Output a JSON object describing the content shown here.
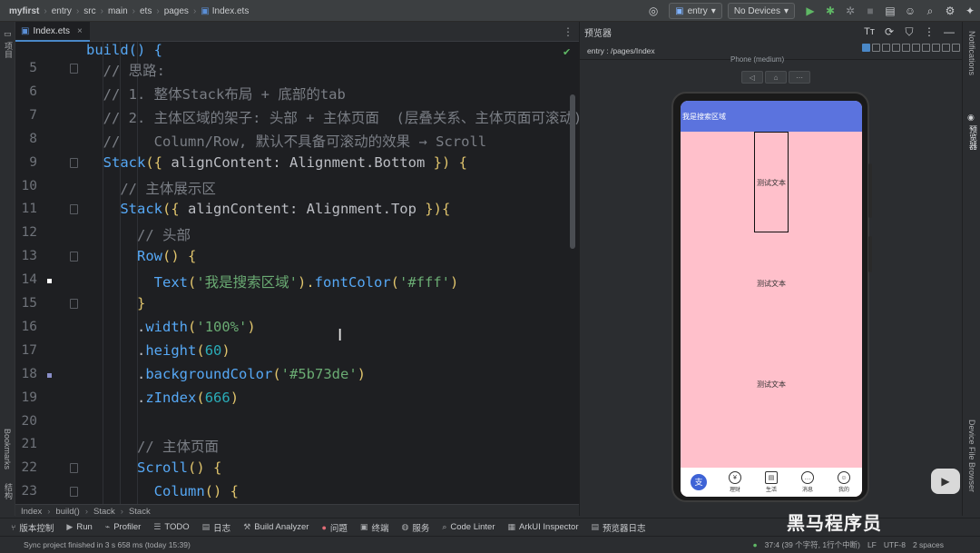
{
  "titlebar": {
    "crumbs": [
      "myfirst",
      "entry",
      "src",
      "main",
      "ets",
      "pages",
      "Index.ets"
    ],
    "entry_dropdown": "entry",
    "devices_dropdown": "No Devices"
  },
  "leftstrip": {
    "project": "项目",
    "bookmarks": "Bookmarks",
    "structure": "结构"
  },
  "editor": {
    "tab": "Index.ets",
    "line_numbers": [
      "5",
      "6",
      "7",
      "8",
      "9",
      "10",
      "11",
      "12",
      "13",
      "14",
      "15",
      "16",
      "17",
      "18",
      "19",
      "20",
      "21",
      "22",
      "23"
    ],
    "partial_first_line": "build() {",
    "lines": [
      {
        "indent": "  ",
        "tokens": [
          {
            "t": "// 思路:",
            "c": "cm"
          }
        ]
      },
      {
        "indent": "  ",
        "tokens": [
          {
            "t": "// 1. 整体Stack布局 + 底部的tab",
            "c": "cm"
          }
        ]
      },
      {
        "indent": "  ",
        "tokens": [
          {
            "t": "// 2. 主体区域的架子: 头部 + 主体页面  (层叠关系、主体页面可滚动)",
            "c": "cm"
          }
        ]
      },
      {
        "indent": "  ",
        "tokens": [
          {
            "t": "//    Column/Row, 默认不具备可滚动的效果 → Scroll",
            "c": "cm"
          }
        ]
      },
      {
        "indent": "  ",
        "tokens": [
          {
            "t": "Stack",
            "c": "fn"
          },
          {
            "t": "({ ",
            "c": "br"
          },
          {
            "t": "alignContent",
            "c": ""
          },
          {
            "t": ": Alignment.",
            "c": ""
          },
          {
            "t": "Bottom",
            "c": ""
          },
          {
            "t": " }) {",
            "c": "br"
          }
        ]
      },
      {
        "indent": "    ",
        "tokens": [
          {
            "t": "// 主体展示区",
            "c": "cm"
          }
        ]
      },
      {
        "indent": "    ",
        "tokens": [
          {
            "t": "Stack",
            "c": "fn"
          },
          {
            "t": "({ ",
            "c": "br"
          },
          {
            "t": "alignContent",
            "c": ""
          },
          {
            "t": ": Alignment.",
            "c": ""
          },
          {
            "t": "Top",
            "c": ""
          },
          {
            "t": " }){",
            "c": "br"
          }
        ]
      },
      {
        "indent": "      ",
        "tokens": [
          {
            "t": "// 头部",
            "c": "cm"
          }
        ]
      },
      {
        "indent": "      ",
        "tokens": [
          {
            "t": "Row",
            "c": "fn"
          },
          {
            "t": "() {",
            "c": "br"
          }
        ]
      },
      {
        "indent": "        ",
        "tokens": [
          {
            "t": "Text",
            "c": "fn"
          },
          {
            "t": "(",
            "c": "br"
          },
          {
            "t": "'我是搜索区域'",
            "c": "st"
          },
          {
            "t": ").",
            "c": "br"
          },
          {
            "t": "fontColor",
            "c": "fn"
          },
          {
            "t": "(",
            "c": "br"
          },
          {
            "t": "'#fff'",
            "c": "st"
          },
          {
            "t": ")",
            "c": "br"
          }
        ]
      },
      {
        "indent": "      ",
        "tokens": [
          {
            "t": "}",
            "c": "br"
          }
        ]
      },
      {
        "indent": "      ",
        "tokens": [
          {
            "t": ".",
            "c": ""
          },
          {
            "t": "width",
            "c": "fn"
          },
          {
            "t": "(",
            "c": "br"
          },
          {
            "t": "'100%'",
            "c": "st"
          },
          {
            "t": ")",
            "c": "br"
          }
        ]
      },
      {
        "indent": "      ",
        "tokens": [
          {
            "t": ".",
            "c": ""
          },
          {
            "t": "height",
            "c": "fn"
          },
          {
            "t": "(",
            "c": "br"
          },
          {
            "t": "60",
            "c": "nm"
          },
          {
            "t": ")",
            "c": "br"
          }
        ]
      },
      {
        "indent": "      ",
        "tokens": [
          {
            "t": ".",
            "c": ""
          },
          {
            "t": "backgroundColor",
            "c": "fn"
          },
          {
            "t": "(",
            "c": "br"
          },
          {
            "t": "'#5b73de'",
            "c": "st"
          },
          {
            "t": ")",
            "c": "br"
          }
        ]
      },
      {
        "indent": "      ",
        "tokens": [
          {
            "t": ".",
            "c": ""
          },
          {
            "t": "zIndex",
            "c": "fn"
          },
          {
            "t": "(",
            "c": "br"
          },
          {
            "t": "666",
            "c": "nm"
          },
          {
            "t": ")",
            "c": "br"
          }
        ]
      },
      {
        "indent": "",
        "tokens": []
      },
      {
        "indent": "      ",
        "tokens": [
          {
            "t": "// 主体页面",
            "c": "cm"
          }
        ]
      },
      {
        "indent": "      ",
        "tokens": [
          {
            "t": "Scroll",
            "c": "fn"
          },
          {
            "t": "() {",
            "c": "br"
          }
        ]
      },
      {
        "indent": "        ",
        "tokens": [
          {
            "t": "Column",
            "c": "fn"
          },
          {
            "t": "() {",
            "c": "br"
          }
        ]
      }
    ]
  },
  "breadcrumb": [
    "Index",
    "build()",
    "Stack",
    "Stack"
  ],
  "preview": {
    "title": "预览器",
    "path": "entry : /pages/Index",
    "device": "Phone (medium)",
    "search_text": "我是搜索区域",
    "body_texts": [
      "测试文本",
      "测试文本",
      "测试文本"
    ],
    "tabs": [
      {
        "label": "",
        "glyph": "支"
      },
      {
        "label": "理财",
        "glyph": "¥"
      },
      {
        "label": "生活",
        "glyph": "▤"
      },
      {
        "label": "消息",
        "glyph": "…"
      },
      {
        "label": "我的",
        "glyph": "☺"
      }
    ],
    "colors": {
      "search_bg": "#5b73de",
      "body_bg": "#ffc0cb",
      "tab_active": "#3e63d6"
    }
  },
  "rightstrip": {
    "notifications": "Notifications",
    "previewer": "预览器",
    "device_browser": "Device File Browser"
  },
  "bottombar": {
    "items": [
      "版本控制",
      "Run",
      "Profiler",
      "TODO",
      "日志",
      "Build Analyzer",
      "问题",
      "终端",
      "服务",
      "Code Linter",
      "ArkUI Inspector",
      "预览器日志"
    ]
  },
  "status": {
    "message": "Sync project finished in 3 s 658 ms (today 15:39)",
    "position": "37:4 (39 个字符, 1行个中断)",
    "line_ending": "LF",
    "encoding": "UTF-8",
    "indent": "2 spaces"
  },
  "watermark": "黑马程序员"
}
